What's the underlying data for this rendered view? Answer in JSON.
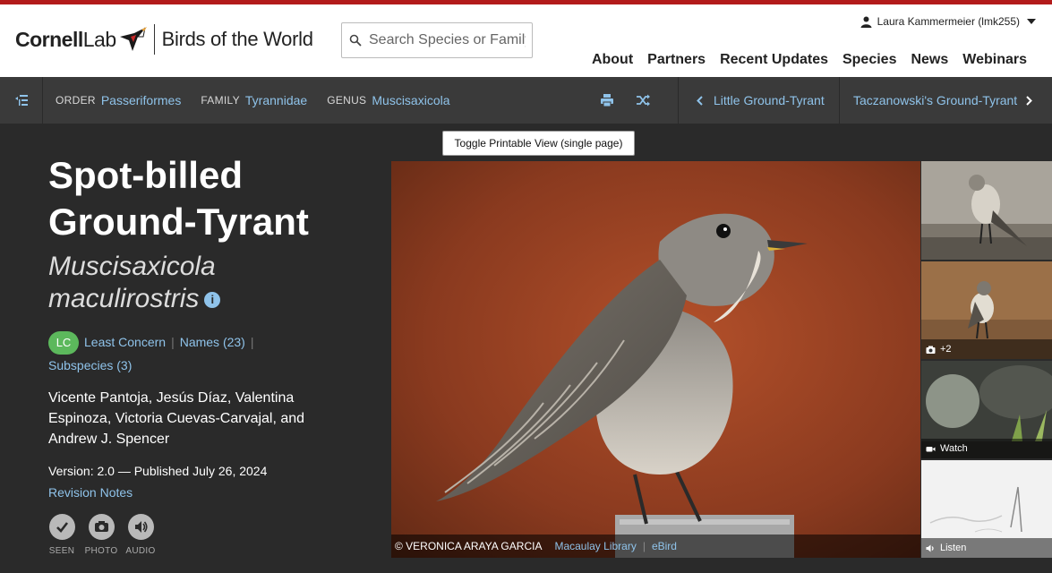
{
  "brand": {
    "cornell": "Cornell",
    "lab": "Lab",
    "product": "Birds of the World"
  },
  "search": {
    "placeholder": "Search Species or Family"
  },
  "user": {
    "name": "Laura Kammermeier (lmk255)"
  },
  "nav": [
    {
      "label": "About"
    },
    {
      "label": "Partners"
    },
    {
      "label": "Recent Updates"
    },
    {
      "label": "Species"
    },
    {
      "label": "News"
    },
    {
      "label": "Webinars"
    }
  ],
  "taxonomy": {
    "order_label": "ORDER",
    "order": "Passeriformes",
    "family_label": "FAMILY",
    "family": "Tyrannidae",
    "genus_label": "GENUS",
    "genus": "Muscisaxicola"
  },
  "siblings": {
    "prev": "Little Ground-Tyrant",
    "next": "Taczanowski's Ground-Tyrant"
  },
  "tooltip": "Toggle Printable View (single page)",
  "species": {
    "common_line1": "Spot-billed",
    "common_line2": "Ground-Tyrant",
    "sci_line1": "Muscisaxicola",
    "sci_line2": "maculirostris",
    "info_glyph": "i",
    "status_code": "LC",
    "status_label": "Least Concern",
    "names_link": "Names (23)",
    "subspecies_link": "Subspecies (3)",
    "authors": "Vicente Pantoja, Jesús Díaz, Valentina Espinoza, Victoria Cuevas-Carvajal, and Andrew J. Spencer",
    "version": "Version: 2.0 — Published July 26, 2024",
    "revision_link": "Revision Notes"
  },
  "actions": [
    {
      "label": "SEEN",
      "icon": "check-icon"
    },
    {
      "label": "PHOTO",
      "icon": "camera-icon"
    },
    {
      "label": "AUDIO",
      "icon": "speaker-icon"
    }
  ],
  "media": {
    "credit": "© VERONICA ARAYA GARCIA",
    "library": "Macaulay Library",
    "ebird": "eBird",
    "photo_more": "+2",
    "watch": "Watch",
    "listen": "Listen"
  },
  "colors": {
    "accent": "#b31b1b",
    "link": "#8fc3ea",
    "lc_green": "#5cb85c",
    "dark_bg": "#2a2a2a"
  }
}
